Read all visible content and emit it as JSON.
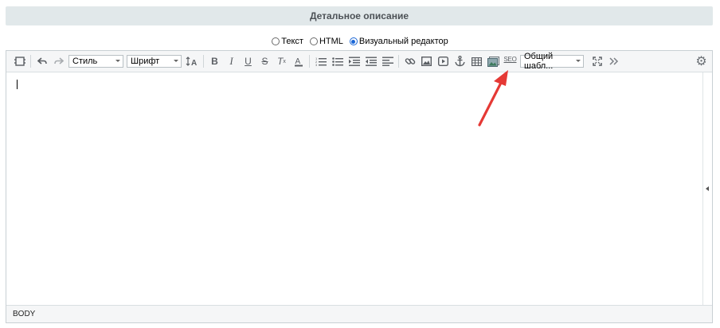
{
  "section": {
    "title": "Детальное описание"
  },
  "mode_selector": {
    "options": [
      {
        "label": "Текст",
        "checked": false
      },
      {
        "label": "HTML",
        "checked": false
      },
      {
        "label": "Визуальный редактор",
        "checked": true
      }
    ]
  },
  "toolbar": {
    "style_select": "Стиль",
    "font_select": "Шрифт",
    "template_select": "Общий шабл...",
    "seo_label": "SEO"
  },
  "statusbar": {
    "path": "BODY"
  },
  "colors": {
    "header_bg": "#e1e8ea",
    "toolbar_bg": "#f5f6f7",
    "annotation_arrow": "#e53935",
    "radio_accent": "#1a66d6"
  }
}
